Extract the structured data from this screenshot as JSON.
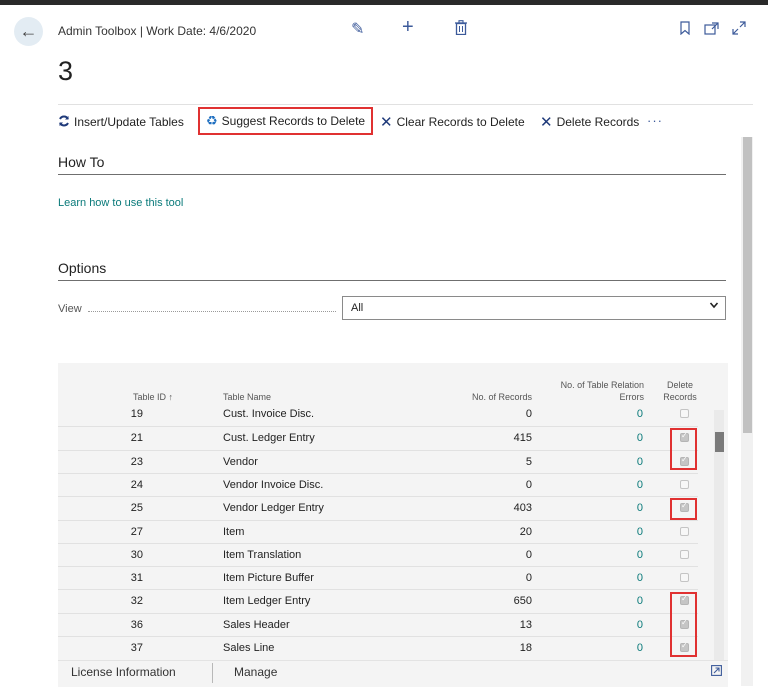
{
  "header": {
    "caption": "Admin Toolbox | Work Date: 4/6/2020",
    "title": "3"
  },
  "actions": [
    {
      "label": "Insert/Update Tables",
      "icon": "refresh-icon"
    },
    {
      "label": "Suggest Records to Delete",
      "icon": "recycle-icon",
      "highlighted": true
    },
    {
      "label": "Clear Records to Delete",
      "icon": "close-icon"
    },
    {
      "label": "Delete Records",
      "icon": "close-icon"
    }
  ],
  "more_label": "···",
  "how_to": {
    "title": "How To",
    "link": "Learn how to use this tool"
  },
  "options": {
    "title": "Options",
    "view_label": "View",
    "view_value": "All"
  },
  "grid": {
    "headers": {
      "table_id": "Table ID ↑",
      "table_name": "Table Name",
      "no_records": "No. of Records",
      "relation_errors_1": "No. of Table Relation",
      "relation_errors_2": "Errors",
      "delete_1": "Delete",
      "delete_2": "Records"
    },
    "rows": [
      {
        "id": "19",
        "name": "Cust. Invoice Disc.",
        "records": "0",
        "errors": "0",
        "delete": false
      },
      {
        "id": "21",
        "name": "Cust. Ledger Entry",
        "records": "415",
        "errors": "0",
        "delete": true
      },
      {
        "id": "23",
        "name": "Vendor",
        "records": "5",
        "errors": "0",
        "delete": true
      },
      {
        "id": "24",
        "name": "Vendor Invoice Disc.",
        "records": "0",
        "errors": "0",
        "delete": false
      },
      {
        "id": "25",
        "name": "Vendor Ledger Entry",
        "records": "403",
        "errors": "0",
        "delete": true
      },
      {
        "id": "27",
        "name": "Item",
        "records": "20",
        "errors": "0",
        "delete": false
      },
      {
        "id": "30",
        "name": "Item Translation",
        "records": "0",
        "errors": "0",
        "delete": false
      },
      {
        "id": "31",
        "name": "Item Picture Buffer",
        "records": "0",
        "errors": "0",
        "delete": false
      },
      {
        "id": "32",
        "name": "Item Ledger Entry",
        "records": "650",
        "errors": "0",
        "delete": true
      },
      {
        "id": "36",
        "name": "Sales Header",
        "records": "13",
        "errors": "0",
        "delete": true
      },
      {
        "id": "37",
        "name": "Sales Line",
        "records": "18",
        "errors": "0",
        "delete": true
      }
    ]
  },
  "footer": {
    "tab1": "License Information",
    "tab2": "Manage"
  }
}
